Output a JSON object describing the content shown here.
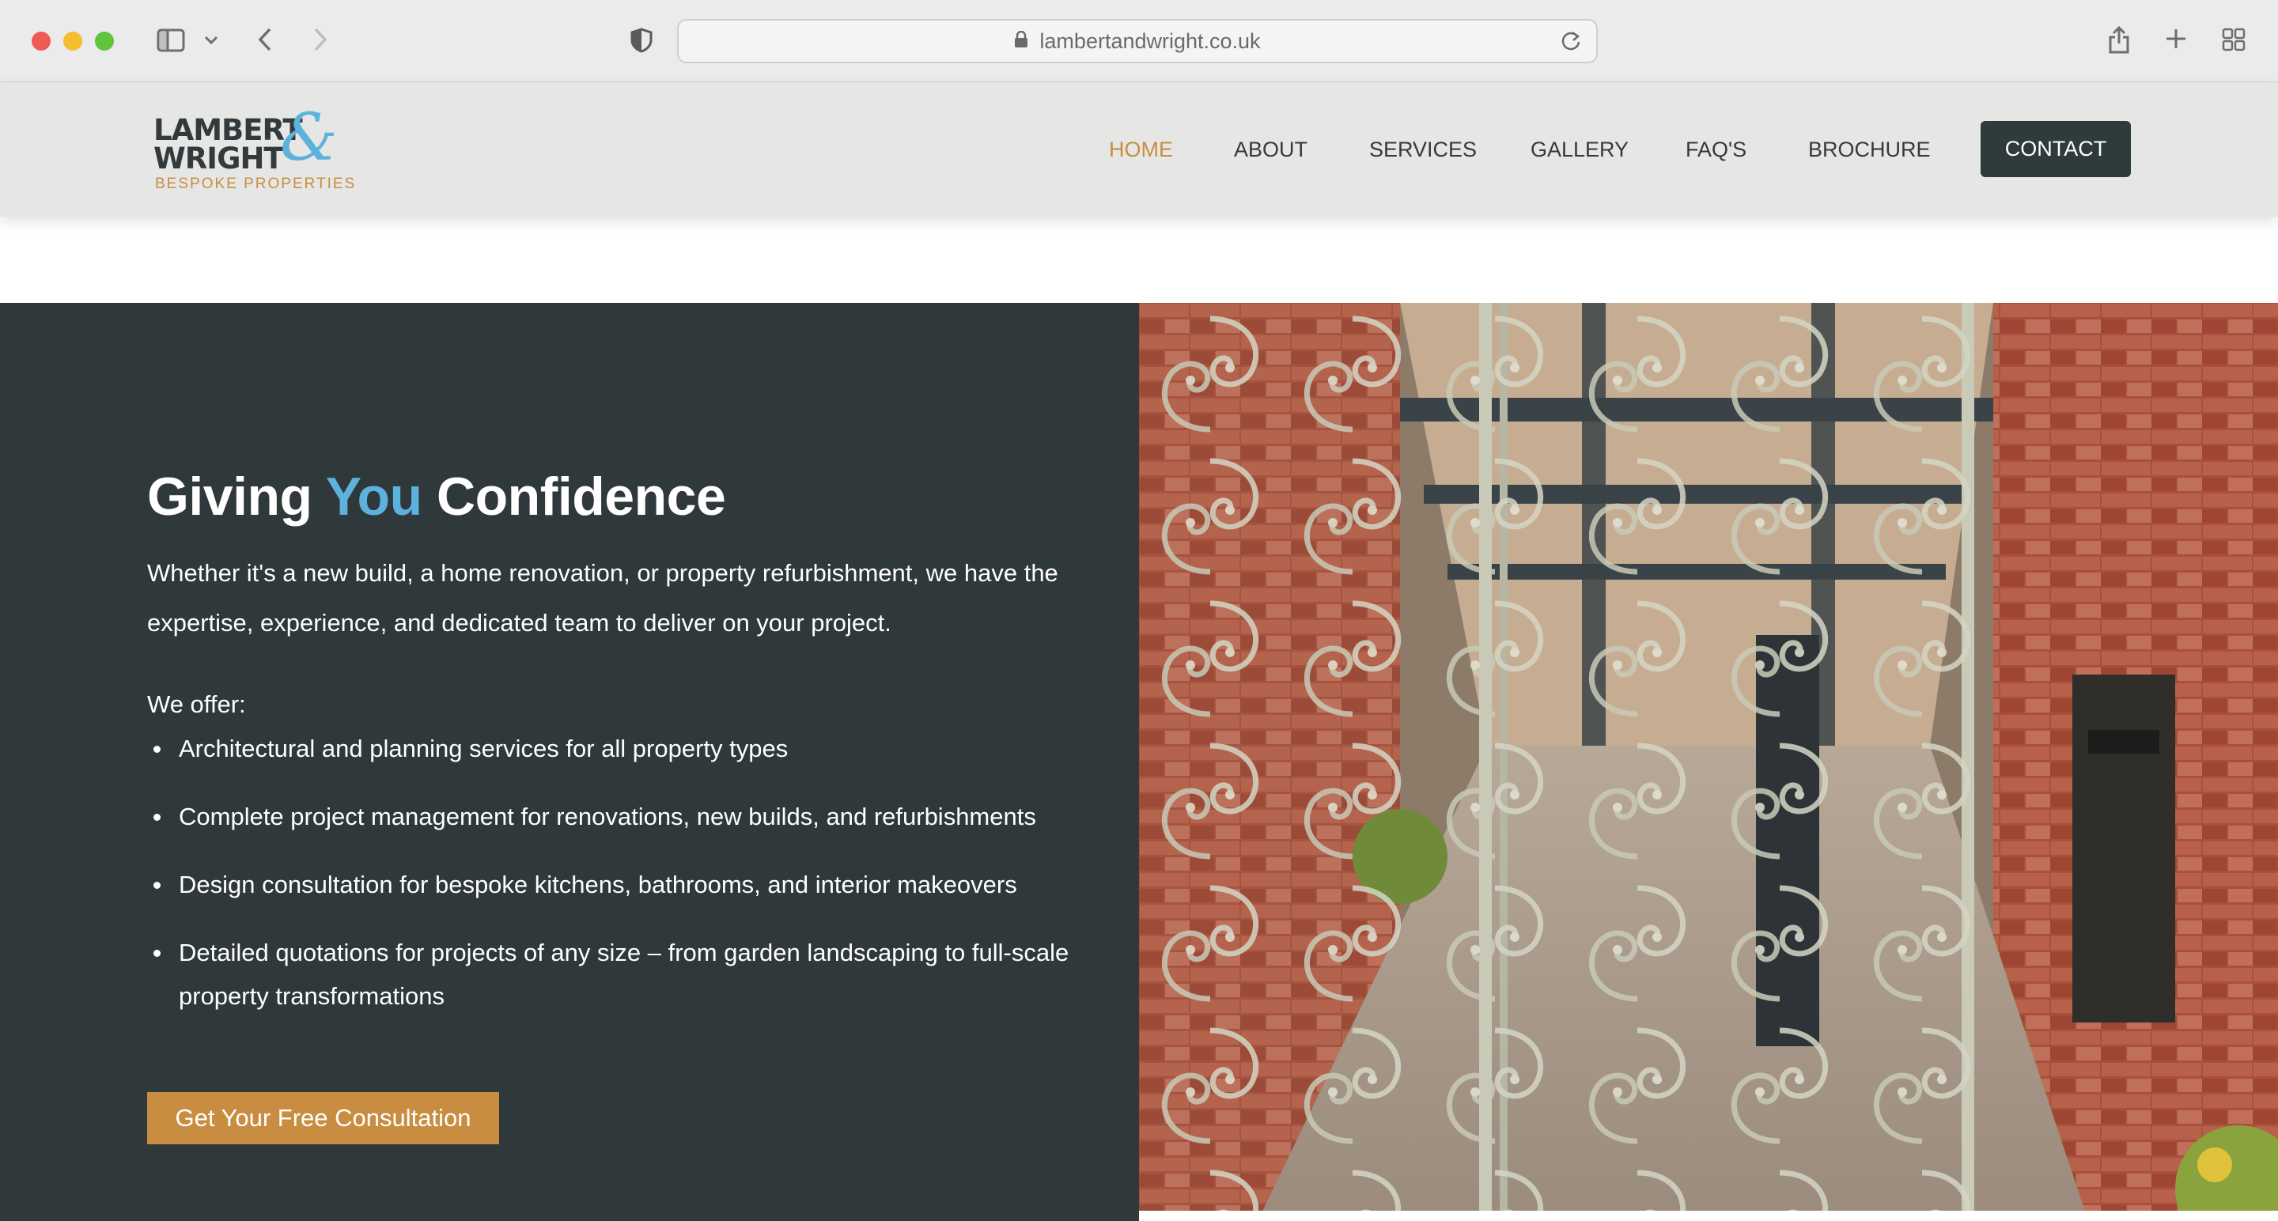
{
  "browser": {
    "url": "lambertandwright.co.uk"
  },
  "header": {
    "logo": {
      "line1": "LAMBERT",
      "line2": "WRIGHT",
      "ampersand": "&",
      "tagline": "BESPOKE PROPERTIES"
    },
    "nav": [
      {
        "label": "HOME",
        "active": true
      },
      {
        "label": "ABOUT",
        "active": false
      },
      {
        "label": "SERVICES",
        "active": false
      },
      {
        "label": "GALLERY",
        "active": false
      },
      {
        "label": "FAQ'S",
        "active": false
      },
      {
        "label": "BROCHURE",
        "active": false
      }
    ],
    "contact_label": "CONTACT"
  },
  "hero": {
    "title_before": "Giving ",
    "title_accent": "You",
    "title_after": " Confidence",
    "intro": "Whether it's a new build, a home renovation, or property refurbishment, we have the expertise, experience, and dedicated team to deliver on your project.",
    "offer_label": "We offer:",
    "offers": [
      "Architectural and planning services for all property types",
      "Complete project management for renovations, new builds, and refurbishments",
      "Design consultation for bespoke kitchens, bathrooms, and interior makeovers",
      "Detailed quotations for projects of any size – from garden landscaping to full-scale property transformations"
    ],
    "cta_label": "Get Your Free Consultation"
  },
  "colors": {
    "accent_blue": "#5cb2dc",
    "accent_gold": "#c88d41",
    "dark_panel": "#2f383b",
    "header_bg": "#e6e6e4"
  }
}
